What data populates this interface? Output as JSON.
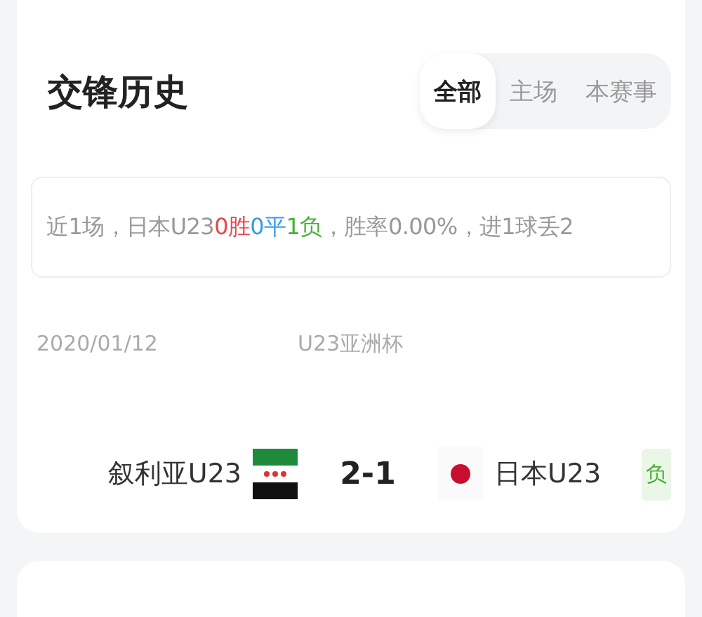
{
  "title": "交锋历史",
  "tabs": [
    {
      "label": "全部",
      "selected": true
    },
    {
      "label": "主场",
      "selected": false
    },
    {
      "label": "本赛事",
      "selected": false
    }
  ],
  "summary": [
    {
      "text": "近1场，日本U23",
      "color": "#999999"
    },
    {
      "text": "0胜",
      "color": "#e5484d"
    },
    {
      "text": "0平",
      "color": "#3b9be8"
    },
    {
      "text": "1负",
      "color": "#4caf3a"
    },
    {
      "text": "，胜率0.00%，进1球丢2",
      "color": "#999999"
    }
  ],
  "matches": [
    {
      "date": "2020/01/12",
      "competition": "U23亚洲杯",
      "home": {
        "name": "叙利亚U23",
        "kind": "syria"
      },
      "score": "2-1",
      "away": {
        "name": "日本U23",
        "kind": "japan"
      },
      "result": "负",
      "color": "#4caf3a"
    }
  ]
}
